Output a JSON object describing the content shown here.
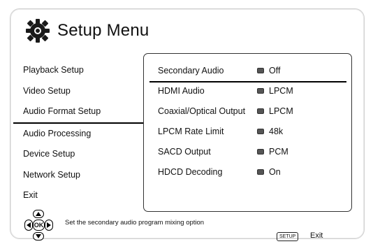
{
  "title": "Setup Menu",
  "menu_items": [
    {
      "label": "Playback Setup"
    },
    {
      "label": "Video Setup"
    },
    {
      "label": "Audio Format Setup"
    },
    {
      "label": "Audio Processing"
    },
    {
      "label": "Device Setup"
    },
    {
      "label": "Network Setup"
    },
    {
      "label": "Exit"
    }
  ],
  "selected_menu_item": "Audio Format Setup",
  "options": [
    {
      "label": "Secondary Audio",
      "value": "Off"
    },
    {
      "label": "HDMI Audio",
      "value": "LPCM"
    },
    {
      "label": "Coaxial/Optical Output",
      "value": "LPCM"
    },
    {
      "label": "LPCM Rate Limit",
      "value": "48k"
    },
    {
      "label": "SACD Output",
      "value": "PCM"
    },
    {
      "label": "HDCD Decoding",
      "value": "On"
    }
  ],
  "selected_option": "Secondary Audio",
  "nav": {
    "ok_label": "OK"
  },
  "help_text": "Set the secondary audio program mixing option",
  "footer": {
    "setup_key": "SETUP",
    "exit_label": "Exit"
  },
  "icons": {
    "title_icon": "gear-icon",
    "nav": [
      "arrow-up-icon",
      "arrow-left-icon",
      "ok-button",
      "arrow-right-icon",
      "arrow-down-icon"
    ]
  },
  "colors": {
    "background": "#ffffff",
    "text": "#111111",
    "border": "#333333"
  }
}
